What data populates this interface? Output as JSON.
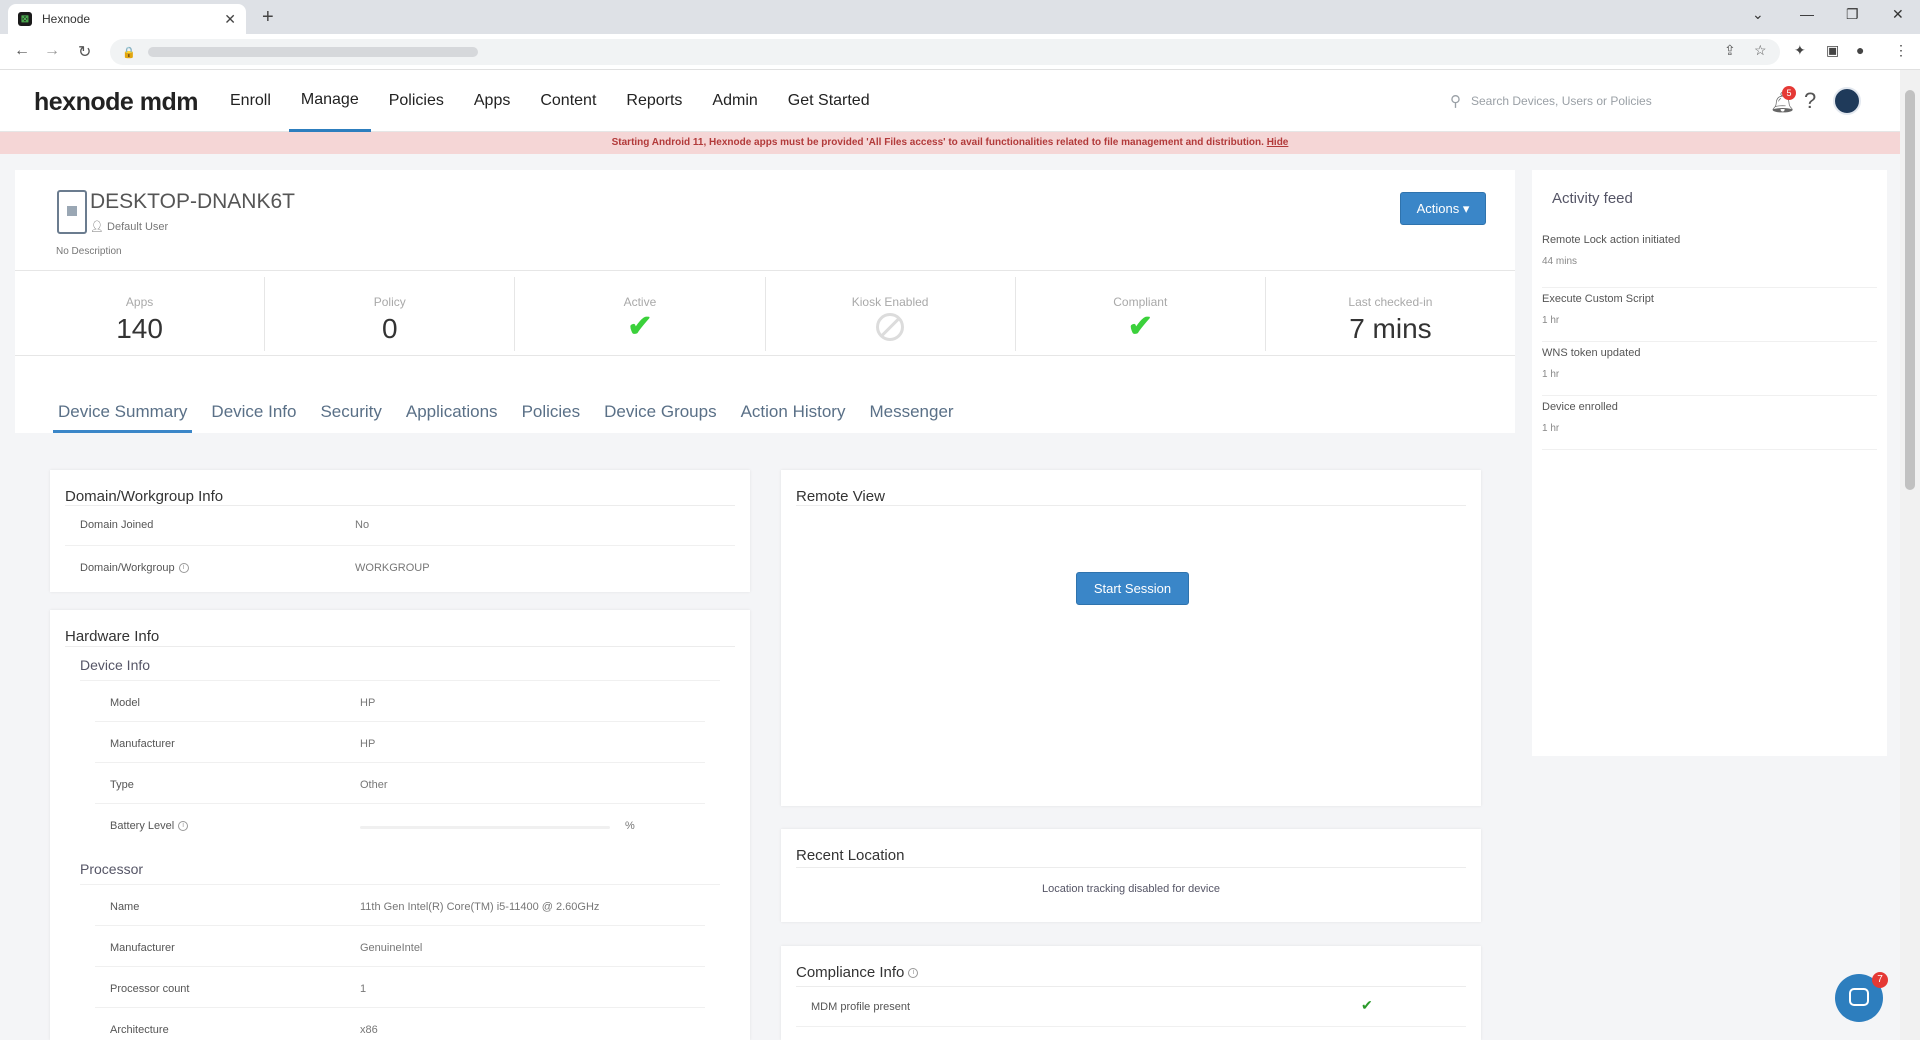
{
  "browser": {
    "tab_title": "Hexnode",
    "tab_close": "✕",
    "new_tab": "+",
    "favicon_glyph": "⊠"
  },
  "app": {
    "logo": "hexnode mdm",
    "nav": [
      "Enroll",
      "Manage",
      "Policies",
      "Apps",
      "Content",
      "Reports",
      "Admin",
      "Get Started"
    ],
    "active_nav": "Manage",
    "search_placeholder": "Search Devices, Users or Policies",
    "notification_count": "5",
    "help": "?"
  },
  "banner": {
    "text": "Starting Android 11, Hexnode apps must be provided 'All Files access' to avail functionalities related to file management and distribution.",
    "link": "Hide"
  },
  "device": {
    "name": "DESKTOP-DNANK6T",
    "user": "Default User",
    "description": "No Description",
    "actions_label": "Actions ▾"
  },
  "stats": {
    "apps_label": "Apps",
    "apps_value": "140",
    "policy_label": "Policy",
    "policy_value": "0",
    "active_label": "Active",
    "kiosk_label": "Kiosk Enabled",
    "compliant_label": "Compliant",
    "checkin_label": "Last checked-in",
    "checkin_value": "7 mins"
  },
  "subtabs": [
    "Device Summary",
    "Device Info",
    "Security",
    "Applications",
    "Policies",
    "Device Groups",
    "Action History",
    "Messenger"
  ],
  "domain": {
    "title": "Domain/Workgroup Info",
    "joined_label": "Domain Joined",
    "joined_value": "No",
    "workgroup_label": "Domain/Workgroup",
    "workgroup_value": "WORKGROUP"
  },
  "hardware": {
    "title": "Hardware Info",
    "device_info_head": "Device Info",
    "model_label": "Model",
    "model_value": "HP",
    "manufacturer_label": "Manufacturer",
    "manufacturer_value": "HP",
    "type_label": "Type",
    "type_value": "Other",
    "battery_label": "Battery Level",
    "battery_unit": "%",
    "processor_head": "Processor",
    "name_label": "Name",
    "name_value": "11th Gen Intel(R) Core(TM) i5-11400 @ 2.60GHz",
    "proc_manufacturer_label": "Manufacturer",
    "proc_manufacturer_value": "GenuineIntel",
    "count_label": "Processor count",
    "count_value": "1",
    "arch_label": "Architecture",
    "arch_value": "x86"
  },
  "remote_view": {
    "title": "Remote View",
    "start_label": "Start Session"
  },
  "location": {
    "title": "Recent Location",
    "text": "Location tracking disabled for device"
  },
  "compliance": {
    "title": "Compliance Info",
    "mdm_label": "MDM profile present"
  },
  "feed": {
    "title": "Activity feed",
    "items": [
      {
        "text": "Remote Lock action initiated",
        "time": "44 mins"
      },
      {
        "text": "Execute Custom Script",
        "time": "1 hr"
      },
      {
        "text": "WNS token updated",
        "time": "1 hr"
      },
      {
        "text": "Device enrolled",
        "time": "1 hr"
      }
    ]
  },
  "chat": {
    "badge": "7"
  },
  "colors": {
    "accent": "#3a86c8",
    "check": "#3bd13b",
    "banner_bg": "#f5d6d6",
    "banner_text": "#b23a3a"
  }
}
